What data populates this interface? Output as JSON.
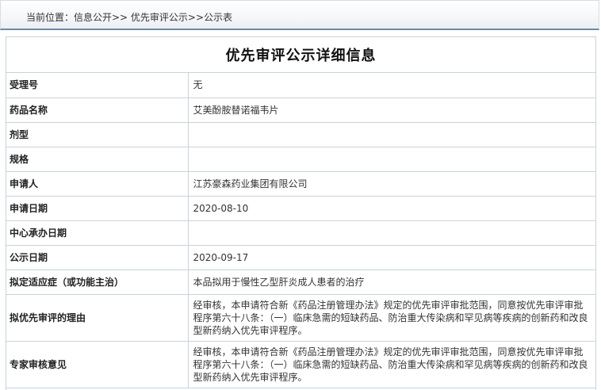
{
  "breadcrumb": {
    "text": "当前位置：信息公开>> 优先审评公示>>公示表"
  },
  "page": {
    "title": "优先审评公示详细信息"
  },
  "rows": [
    {
      "label": "受理号",
      "value": "无"
    },
    {
      "label": "药品名称",
      "value": "艾美酚胺替诺福韦片"
    },
    {
      "label": "剂型",
      "value": ""
    },
    {
      "label": "规格",
      "value": ""
    },
    {
      "label": "申请人",
      "value": "江苏豪森药业集团有限公司"
    },
    {
      "label": "申请日期",
      "value": "2020-08-10"
    },
    {
      "label": "中心承办日期",
      "value": ""
    },
    {
      "label": "公示日期",
      "value": "2020-09-17"
    },
    {
      "label": "拟定适应症（或功能主治）",
      "value": "本品拟用于慢性乙型肝炎成人患者的治疗"
    },
    {
      "label": "拟优先审评的理由",
      "value": "经审核，本申请符合新《药品注册管理办法》规定的优先审评审批范围，同意按优先审评审批程序第六十八条：（一）临床急需的短缺药品、防治重大传染病和罕见病等疾病的创新药和改良型新药纳入优先审评程序。"
    },
    {
      "label": "专家审核意见",
      "value": "经审核，本申请符合新《药品注册管理办法》规定的优先审评审批范围，同意按优先审评审批程序第六十八条：（一）临床急需的短缺药品、防治重大传染病和罕见病等疾病的创新药和改良型新药纳入优先审评程序。"
    }
  ]
}
